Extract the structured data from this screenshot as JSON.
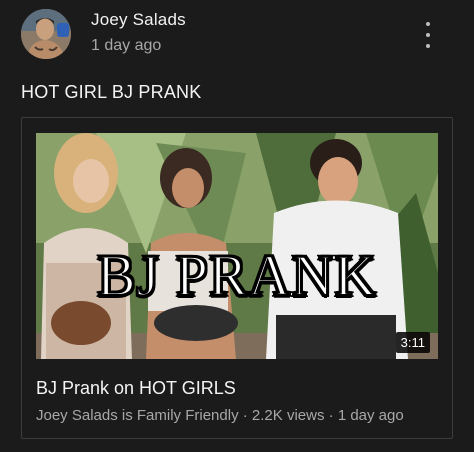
{
  "post": {
    "author": "Joey Salads",
    "timestamp": "1 day ago",
    "text": "HOT GIRL BJ PRANK",
    "menu_icon": "more-vert-icon"
  },
  "video": {
    "thumbnail_text": "BJ PRANK",
    "duration": "3:11",
    "title": "BJ Prank on HOT GIRLS",
    "channel": "Joey Salads is Family Friendly",
    "views": "2.2K views",
    "age": "1 day ago"
  },
  "colors": {
    "background": "#1b1b1b",
    "primary_text": "#f4f4f4",
    "secondary_text": "#a8a8a8",
    "card_border": "#3d3d3d"
  }
}
